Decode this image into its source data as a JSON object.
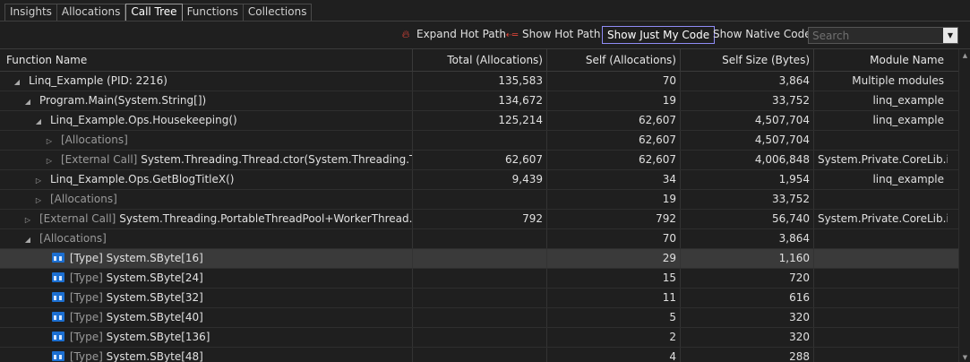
{
  "tabs": [
    {
      "label": "Insights",
      "active": false
    },
    {
      "label": "Allocations",
      "active": false
    },
    {
      "label": "Call Tree",
      "active": true
    },
    {
      "label": "Functions",
      "active": false
    },
    {
      "label": "Collections",
      "active": false
    }
  ],
  "toolbar": {
    "expand_hot_path": "Expand Hot Path",
    "show_hot_path": "Show Hot Path",
    "show_just_my_code": "Show Just My Code",
    "show_native_code": "Show Native Code",
    "search_placeholder": "Search"
  },
  "columns": {
    "function_name": "Function Name",
    "total_allocations": "Total (Allocations)",
    "self_allocations": "Self (Allocations)",
    "self_size": "Self Size (Bytes)",
    "module_name": "Module Name"
  },
  "rows": [
    {
      "prefix": "",
      "name": "Linq_Example (PID: 2216)",
      "total": "135,583",
      "self": "70",
      "size": "3,864",
      "module": "Multiple modules"
    },
    {
      "prefix": "",
      "name": "Program.Main(System.String[])",
      "total": "134,672",
      "self": "19",
      "size": "33,752",
      "module": "linq_example"
    },
    {
      "prefix": "",
      "name": "Linq_Example.Ops.Housekeeping()",
      "total": "125,214",
      "self": "62,607",
      "size": "4,507,704",
      "module": "linq_example"
    },
    {
      "prefix": "[Allocations]",
      "name": "",
      "total": "",
      "self": "62,607",
      "size": "4,507,704",
      "module": ""
    },
    {
      "prefix": "[External Call]",
      "name": "System.Threading.Thread.ctor(System.Threading.ThreadS...",
      "total": "62,607",
      "self": "62,607",
      "size": "4,006,848",
      "module": "System.Private.CoreLib.il"
    },
    {
      "prefix": "",
      "name": "Linq_Example.Ops.GetBlogTitleX()",
      "total": "9,439",
      "self": "34",
      "size": "1,954",
      "module": "linq_example"
    },
    {
      "prefix": "[Allocations]",
      "name": "",
      "total": "",
      "self": "19",
      "size": "33,752",
      "module": ""
    },
    {
      "prefix": "[External Call]",
      "name": "System.Threading.PortableThreadPool+WorkerThread.Worker...",
      "total": "792",
      "self": "792",
      "size": "56,740",
      "module": "System.Private.CoreLib.il"
    },
    {
      "prefix": "[Allocations]",
      "name": "",
      "total": "",
      "self": "70",
      "size": "3,864",
      "module": ""
    },
    {
      "prefix": "[Type]",
      "name": "System.SByte[16]",
      "total": "",
      "self": "29",
      "size": "1,160",
      "module": ""
    },
    {
      "prefix": "[Type]",
      "name": "System.SByte[24]",
      "total": "",
      "self": "15",
      "size": "720",
      "module": ""
    },
    {
      "prefix": "[Type]",
      "name": "System.SByte[32]",
      "total": "",
      "self": "11",
      "size": "616",
      "module": ""
    },
    {
      "prefix": "[Type]",
      "name": "System.SByte[40]",
      "total": "",
      "self": "5",
      "size": "320",
      "module": ""
    },
    {
      "prefix": "[Type]",
      "name": "System.SByte[136]",
      "total": "",
      "self": "2",
      "size": "320",
      "module": ""
    },
    {
      "prefix": "[Type]",
      "name": "System.SByte[48]",
      "total": "",
      "self": "4",
      "size": "288",
      "module": ""
    }
  ]
}
